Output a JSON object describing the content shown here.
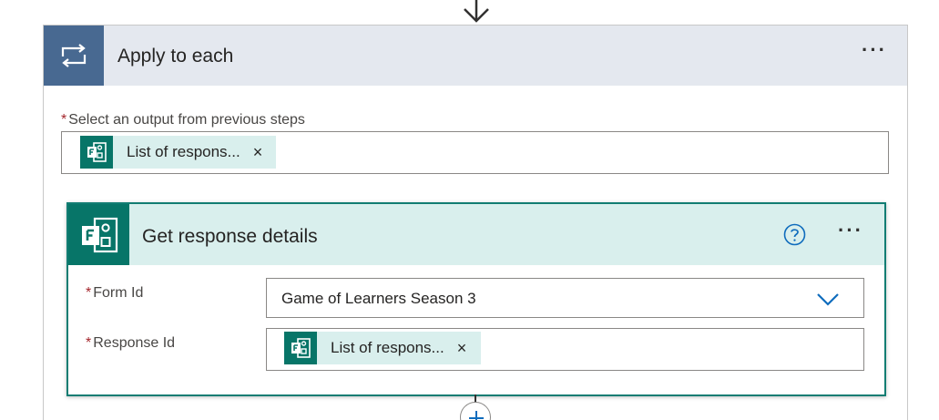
{
  "outer_action": {
    "title": "Apply to each",
    "select_label": "Select an output from previous steps",
    "token": {
      "text": "List of respons...",
      "close_symbol": "×"
    },
    "more_symbol": "···"
  },
  "inner_action": {
    "title": "Get response details",
    "more_symbol": "···",
    "form_id": {
      "label": "Form Id",
      "value": "Game of Learners Season 3"
    },
    "response_id": {
      "label": "Response Id",
      "token": {
        "text": "List of respons...",
        "close_symbol": "×"
      }
    }
  },
  "required_marker": "*",
  "colors": {
    "loop_header_bg": "#e4e8ef",
    "loop_icon_bg": "#486991",
    "forms_accent": "#077568",
    "forms_header_bg": "#d9efed",
    "card_border": "#127d73",
    "required_star": "#a4262c",
    "link_blue": "#0f6cbd"
  },
  "icons": {
    "flow_arrow": "down-arrow-icon",
    "loop": "loop-icon",
    "forms": "forms-icon",
    "help": "help-circle-icon",
    "dropdown": "chevron-down-icon",
    "add": "plus-icon"
  }
}
